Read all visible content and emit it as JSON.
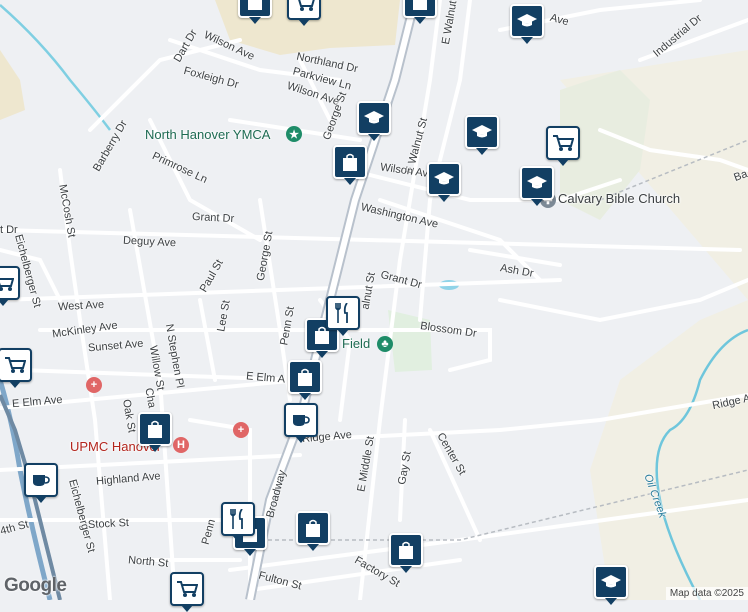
{
  "streets": {
    "wilson_ave_nw": "Wilson Ave",
    "dart_dr": "Dart Dr",
    "northland_dr": "Northland Dr",
    "foxleigh_dr": "Foxleigh Dr",
    "parkview_ln": "Parkview Ln",
    "wilson_ave_mid": "Wilson Ave",
    "george_st_n": "George St",
    "e_walnut_st_top": "E Walnut St",
    "e_walnut_st": "E Walnut St",
    "ave_top_right": "Ave",
    "industrial_dr": "Industrial Dr",
    "barberry_dr": "Barberry Dr",
    "primrose_ln": "Primrose Ln",
    "wilson_ave_e": "Wilson Ave",
    "mccosh_st": "McCosh St",
    "grant_dr_w": "Grant Dr",
    "washington_ave": "Washington Ave",
    "deguy_ave": "Deguy Ave",
    "george_st": "George St",
    "eichelberger_st_n": "Eichelberger St",
    "paul_st": "Paul St",
    "ash_dr": "Ash Dr",
    "grant_dr_e": "Grant Dr",
    "walnut_st": "alnut St",
    "west_ave": "West Ave",
    "lee_st": "Lee St",
    "penn_st": "Penn St",
    "blossom_dr": "Blossom Dr",
    "mckinley_ave": "McKinley Ave",
    "n_stephen_pl": "N Stephen Pl",
    "sunset_ave": "Sunset Ave",
    "willow_st": "Willow St",
    "e_elm_ave_w": "E Elm Ave",
    "e_elm_ave_mid": "E Elm A",
    "ridge_ave_e": "Ridge Ave",
    "oak_st": "Oak St",
    "cha": "Cha",
    "ridge_ave": "Ridge Ave",
    "e_middle_st": "E Middle St",
    "gay_st": "Gay St",
    "center_st": "Center St",
    "highland_ave": "Highland Ave",
    "eichelberger_st_s": "Eichelberger St",
    "stock_st": "Stock St",
    "fourth_st": "4th St",
    "broadway": "Broadway",
    "penn": "Penn",
    "north_st": "North St",
    "factory_st": "Factory St",
    "fulton_st": "Fulton St",
    "ave_right_edge": "Ba",
    "ave_left_edge": "t Dr"
  },
  "places": {
    "ymca": "North Hanover YMCA",
    "calvary": "Calvary Bible Church",
    "upmc": "UPMC Hanover",
    "field": "Field",
    "oil_creek": "Oil Creek"
  },
  "icons": {
    "school": "graduation-cap-icon",
    "shop": "shopping-bag-icon",
    "grocery": "shopping-cart-icon",
    "food": "fork-knife-icon",
    "cafe": "coffee-cup-icon",
    "hospital": "hospital-icon",
    "park": "tree-icon"
  },
  "colors": {
    "pin": "#123f63",
    "green_label": "#1e6b52",
    "hospital": "#e06666",
    "water": "#6fc6dc",
    "road": "#ffffff",
    "major_road": "#b8c1cc"
  },
  "branding": {
    "logo": "Google",
    "attribution": "Map data ©2025"
  }
}
